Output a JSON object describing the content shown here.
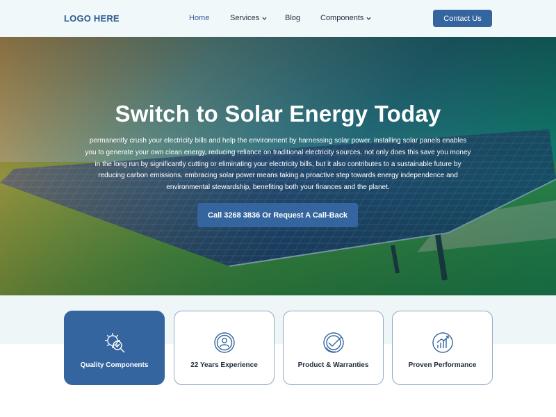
{
  "nav": {
    "logo": "LOGO HERE",
    "items": [
      {
        "label": "Home"
      },
      {
        "label": "Services"
      },
      {
        "label": "Blog"
      },
      {
        "label": "Components"
      }
    ],
    "contact_label": "Contact Us"
  },
  "hero": {
    "title": "Switch to Solar Energy Today",
    "text": "permanently crush your electricity bills and help the environment by harnessing solar power. installing solar panels enables you to generate your own clean energy, reducing reliance on traditional electricity sources. not only does this save you money in the long run by significantly cutting or eliminating your electricity bills, but it also contributes to a sustainable future by reducing carbon emissions. embracing solar power means taking a proactive step towards energy independence and environmental stewardship, benefiting both your finances and the planet.",
    "cta_label": "Call 3268 3836 Or Request A Call-Back"
  },
  "features": [
    {
      "label": "Quality Components",
      "icon": "gear-search-icon"
    },
    {
      "label": "22 Years Experience",
      "icon": "person-badge-icon"
    },
    {
      "label": "Product & Warranties",
      "icon": "check-seal-icon"
    },
    {
      "label": "Proven Performance",
      "icon": "growth-chart-icon"
    }
  ],
  "colors": {
    "brand": "#35659e",
    "nav_background": "#f1f8f9",
    "card_border": "#90a9c9"
  }
}
